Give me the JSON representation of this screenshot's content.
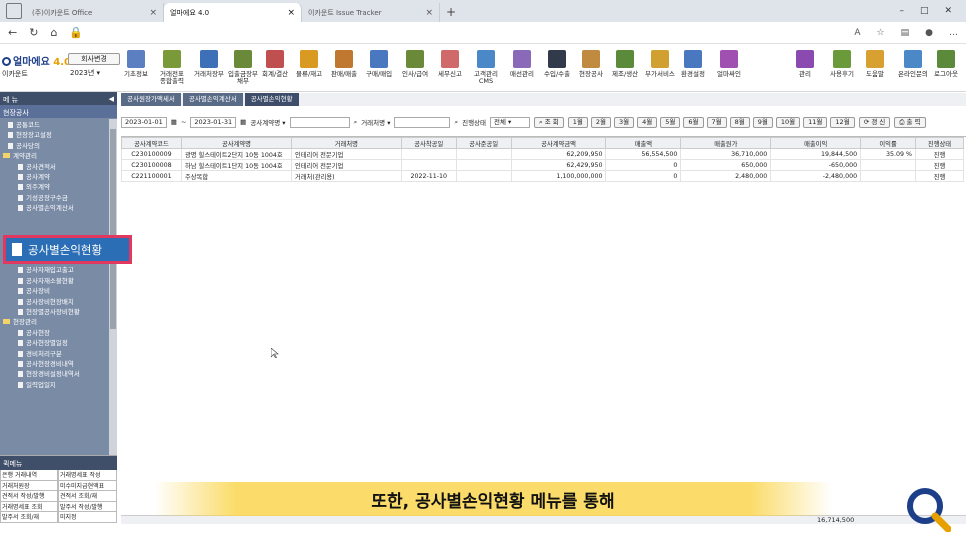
{
  "browser": {
    "tabs": [
      {
        "label": "(주)이카운트 Office",
        "active": false
      },
      {
        "label": "얼마에요 4.0",
        "active": true
      },
      {
        "label": "이카운트 Issue Tracker",
        "active": false
      }
    ]
  },
  "app": {
    "logo_text": "얼마에요",
    "logo_ver": "4.0",
    "company": "이카운트",
    "company_button": "회사변경",
    "year": "2023년"
  },
  "toolbar": [
    "기초정보",
    "거래전표\n종합출력",
    "거래처장부",
    "입출금장부\n채무",
    "회계/결산",
    "물류/재고",
    "판매/매출",
    "구매/매입",
    "인사/급여",
    "세무신고",
    "고객관리\nCMS",
    "매선관리",
    "수입/수출",
    "현장공사",
    "제조/생산",
    "부가서비스",
    "환경설정",
    "얼마싸인"
  ],
  "toolbar_right": [
    "관리",
    "사용후기",
    "도움말",
    "온라인문의",
    "로그아웃"
  ],
  "sidebar": {
    "header": "메 뉴",
    "section": "현장공사",
    "items": [
      {
        "t": "공통코드",
        "k": "file"
      },
      {
        "t": "현장장고설정",
        "k": "file"
      },
      {
        "t": "공사당의",
        "k": "file"
      },
      {
        "t": "계약관리",
        "k": "folder"
      },
      {
        "t": "공사견적서",
        "k": "file2"
      },
      {
        "t": "공사계약",
        "k": "file2"
      },
      {
        "t": "외주계약",
        "k": "file2"
      },
      {
        "t": "기성공장구수금",
        "k": "file2"
      },
      {
        "t": "공사별손익계산서",
        "k": "file2"
      },
      {
        "t": "",
        "k": "blank"
      },
      {
        "t": "",
        "k": "blank"
      },
      {
        "t": "자재관리",
        "k": "folder"
      },
      {
        "t": "공사자재",
        "k": "file2"
      },
      {
        "t": "공사자재발주",
        "k": "file2"
      },
      {
        "t": "공사자재입고출고",
        "k": "file2"
      },
      {
        "t": "공사자재소불현황",
        "k": "file2"
      },
      {
        "t": "공사장비",
        "k": "file2"
      },
      {
        "t": "공사장비현장배치",
        "k": "file2"
      },
      {
        "t": "현장별공사장비현황",
        "k": "file2"
      },
      {
        "t": "현장관리",
        "k": "folder"
      },
      {
        "t": "공사현장",
        "k": "file2"
      },
      {
        "t": "공사현장별일정",
        "k": "file2"
      },
      {
        "t": "경비처리구분",
        "k": "file2"
      },
      {
        "t": "공사현장경비내역",
        "k": "file2"
      },
      {
        "t": "현장경비설정내역서",
        "k": "file2"
      },
      {
        "t": "일력업일지",
        "k": "file2"
      }
    ]
  },
  "callout": "공사별손익현황",
  "quickmenu": {
    "header": "퀵메뉴",
    "items": [
      "은행 거래내역",
      "거래명세표 작성",
      "거래처원장",
      "미수미지급현액표",
      "견적서 작성/발행",
      "견적서 조회/재",
      "거래명세표 조회",
      "발주서 작성/발행",
      "발주서 조회/재",
      "미지정"
    ]
  },
  "content_tabs": [
    "공사원장가액세서",
    "공사별손익계산서",
    "공사별손익현황"
  ],
  "filter": {
    "date_from": "2023-01-01",
    "date_to": "2023-01-31",
    "contract_label": "공사계약명 ▾",
    "client_label": "거래처명 ▾",
    "status_label": "진행상태",
    "status_value": "전체",
    "search": "조 회",
    "months": [
      "1월",
      "2월",
      "3월",
      "4월",
      "5월",
      "6월",
      "7월",
      "8월",
      "9월",
      "10월",
      "11월",
      "12월"
    ],
    "refresh": "갱 신",
    "print": "출 력"
  },
  "table": {
    "headers": [
      "공사계약코드",
      "공사계약명",
      "거래처명",
      "공사착공일",
      "공사준공일",
      "공사계약금액",
      "매출액",
      "매출원가",
      "매출이익",
      "이익률",
      "진행상태"
    ],
    "rows": [
      [
        "C230100009",
        "광명 힐스테이트2단지 10동 1004호",
        "인테리어 전문기업",
        "",
        "",
        "62,209,950",
        "56,554,500",
        "36,710,000",
        "19,844,500",
        "35.09 %",
        "진행"
      ],
      [
        "C230100008",
        "하남 힐스테이트1단지 10동 1004호",
        "인테리어 전문기업",
        "",
        "",
        "62,429,950",
        "0",
        "650,000",
        "-650,000",
        "",
        "진행"
      ],
      [
        "C221100001",
        "주상복합",
        "거래처(관리용)",
        "2022-11-10",
        "",
        "1,100,000,000",
        "0",
        "2,480,000",
        "-2,480,000",
        "",
        "진행"
      ]
    ]
  },
  "sum_value": "16,714,500",
  "subtitle": "또한, 공사별손익현황 메뉴를 통해",
  "colors": {
    "sidebar": "#7a8ba6",
    "callout": "#2b6eb5",
    "callout_border": "#e0385f",
    "subtitle_bg": "#fad650"
  }
}
